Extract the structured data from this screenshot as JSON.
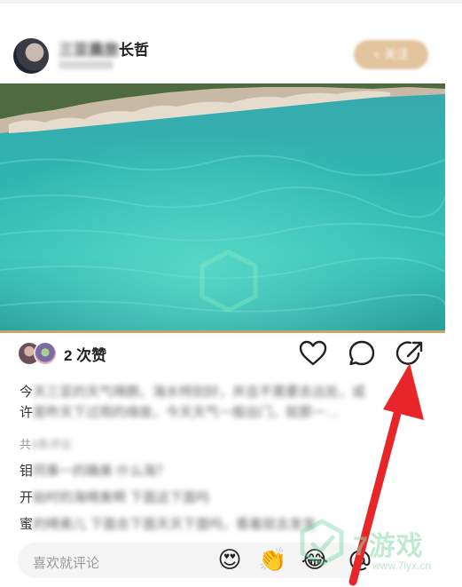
{
  "header": {
    "username_blurred": "三亚晨旅",
    "username_clear": "长哲",
    "follow_label": "+ 关注"
  },
  "post": {
    "likes_text": "2 次赞",
    "caption_line1_start": "今",
    "caption_line1_blur": "天三亚的天气晴朗，海水特别好，并且不需要去远处，或",
    "caption_line2_start": "许",
    "caption_line2_blur": "是昨天下过雨的缘故，今天天气一般出门，就那一…"
  },
  "comments": {
    "header_start": "共",
    "header_blur": "3条评论",
    "items": [
      {
        "first": "钼",
        "rest": "同事一的确美 什么海？"
      },
      {
        "first": "开",
        "rest": "始时的海晴美啊 下面这下面吗"
      },
      {
        "first": "蜜",
        "rest": "的晴美儿 下面去下面天天下面吗，看着就去发发"
      }
    ]
  },
  "comment_bar": {
    "placeholder": "喜欢就评论",
    "emojis": [
      "😍",
      "👏",
      "😂"
    ]
  },
  "watermark": {
    "text": "7游戏",
    "url": "www.7lyx.cn"
  },
  "colors": {
    "accent_gold": "#e2c49d",
    "arrow_red": "#e8262a",
    "progress_gold": "#c6a56a"
  },
  "icons": [
    "heart-icon",
    "comment-icon",
    "share-icon",
    "at-icon"
  ]
}
